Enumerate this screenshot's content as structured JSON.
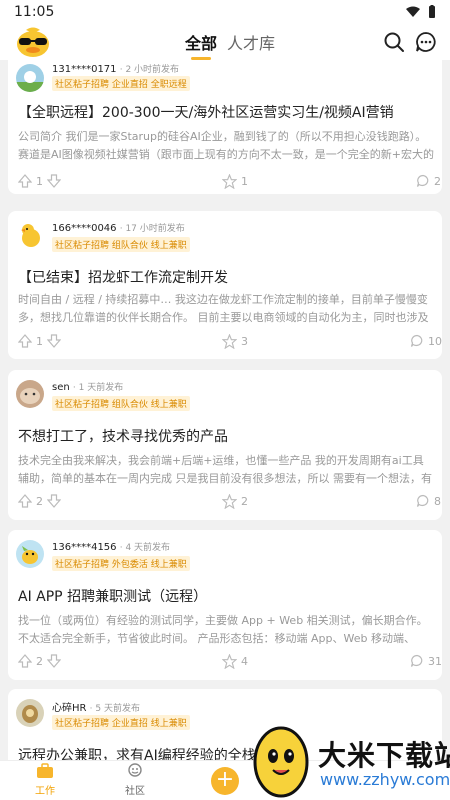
{
  "status_bar": {
    "time": "11:05"
  },
  "header": {
    "tabs": [
      "全部",
      "人才库"
    ]
  },
  "posts": [
    {
      "user": "131****0171",
      "time": "· 2 小时前发布",
      "badge": "社区粘子招聘 企业直招 全职远程",
      "title": "【全职远程】200-300一天/海外社区运营实习生/视频AI营销",
      "desc": "公司简介 我们是一家Starup的硅谷AI企业，融到钱了的（所以不用担心没钱跑路）。赛道是AI图像视频社媒营销（跟市面上现有的方向不太一致，是一个完全的新+宏大的方",
      "likes": "1",
      "stars": "1",
      "comments": "2"
    },
    {
      "user": "166****0046",
      "time": "· 17 小时前发布",
      "badge": "社区粘子招聘 组队合伙 线上兼职",
      "title": "【已结束】招龙虾工作流定制开发",
      "desc": "时间自由 / 远程 / 持续招募中… 我这边在做龙虾工作流定制的接单，目前单子慢慢变多，想找几位靠谱的伙伴长期合作。 目前主要以电商领域的自动化为主，同时也涉及",
      "likes": "1",
      "stars": "3",
      "comments": "10"
    },
    {
      "user": "sen",
      "time": "· 1 天前发布",
      "badge": "社区粘子招聘 组队合伙 线上兼职",
      "title": "不想打工了，技术寻找优秀的产品",
      "desc": "技术完全由我来解决，我会前端+后端+运维，也懂一些产品 我的开发周期有ai工具辅助，简单的基本在一周内完成 只是我目前没有很多想法，所以 需要有一个想法，有市",
      "likes": "2",
      "stars": "2",
      "comments": "8"
    },
    {
      "user": "136****4156",
      "time": "· 4 天前发布",
      "badge": "社区粘子招聘 外包委活 线上兼职",
      "title": "AI APP 招聘兼职测试（远程）",
      "desc": "找一位（或两位）有经验的测试同学，主要做 App + Web 相关测试，偏长期合作。 不太适合完全新手，节省彼此时间。 产品形态包括：移动端 App、Web 移动端、Web 网",
      "likes": "2",
      "stars": "4",
      "comments": "31"
    },
    {
      "user": "心碎HR",
      "time": "· 5 天前发布",
      "badge": "社区粘子招聘 企业直招 线上兼职",
      "title": "远程办公兼职，求有AI编程经验的全栈大",
      "desc": "",
      "likes": "",
      "stars": "",
      "comments": ""
    }
  ],
  "bottom_nav": {
    "work": "工作",
    "community": "社区",
    "add": "+"
  },
  "watermark": {
    "name": "大米下载站",
    "url": "www.zzhyw.com"
  },
  "colors": {
    "accent": "#f7b52c",
    "badge_text": "#d98a00",
    "badge_bg": "#fff2d6"
  }
}
